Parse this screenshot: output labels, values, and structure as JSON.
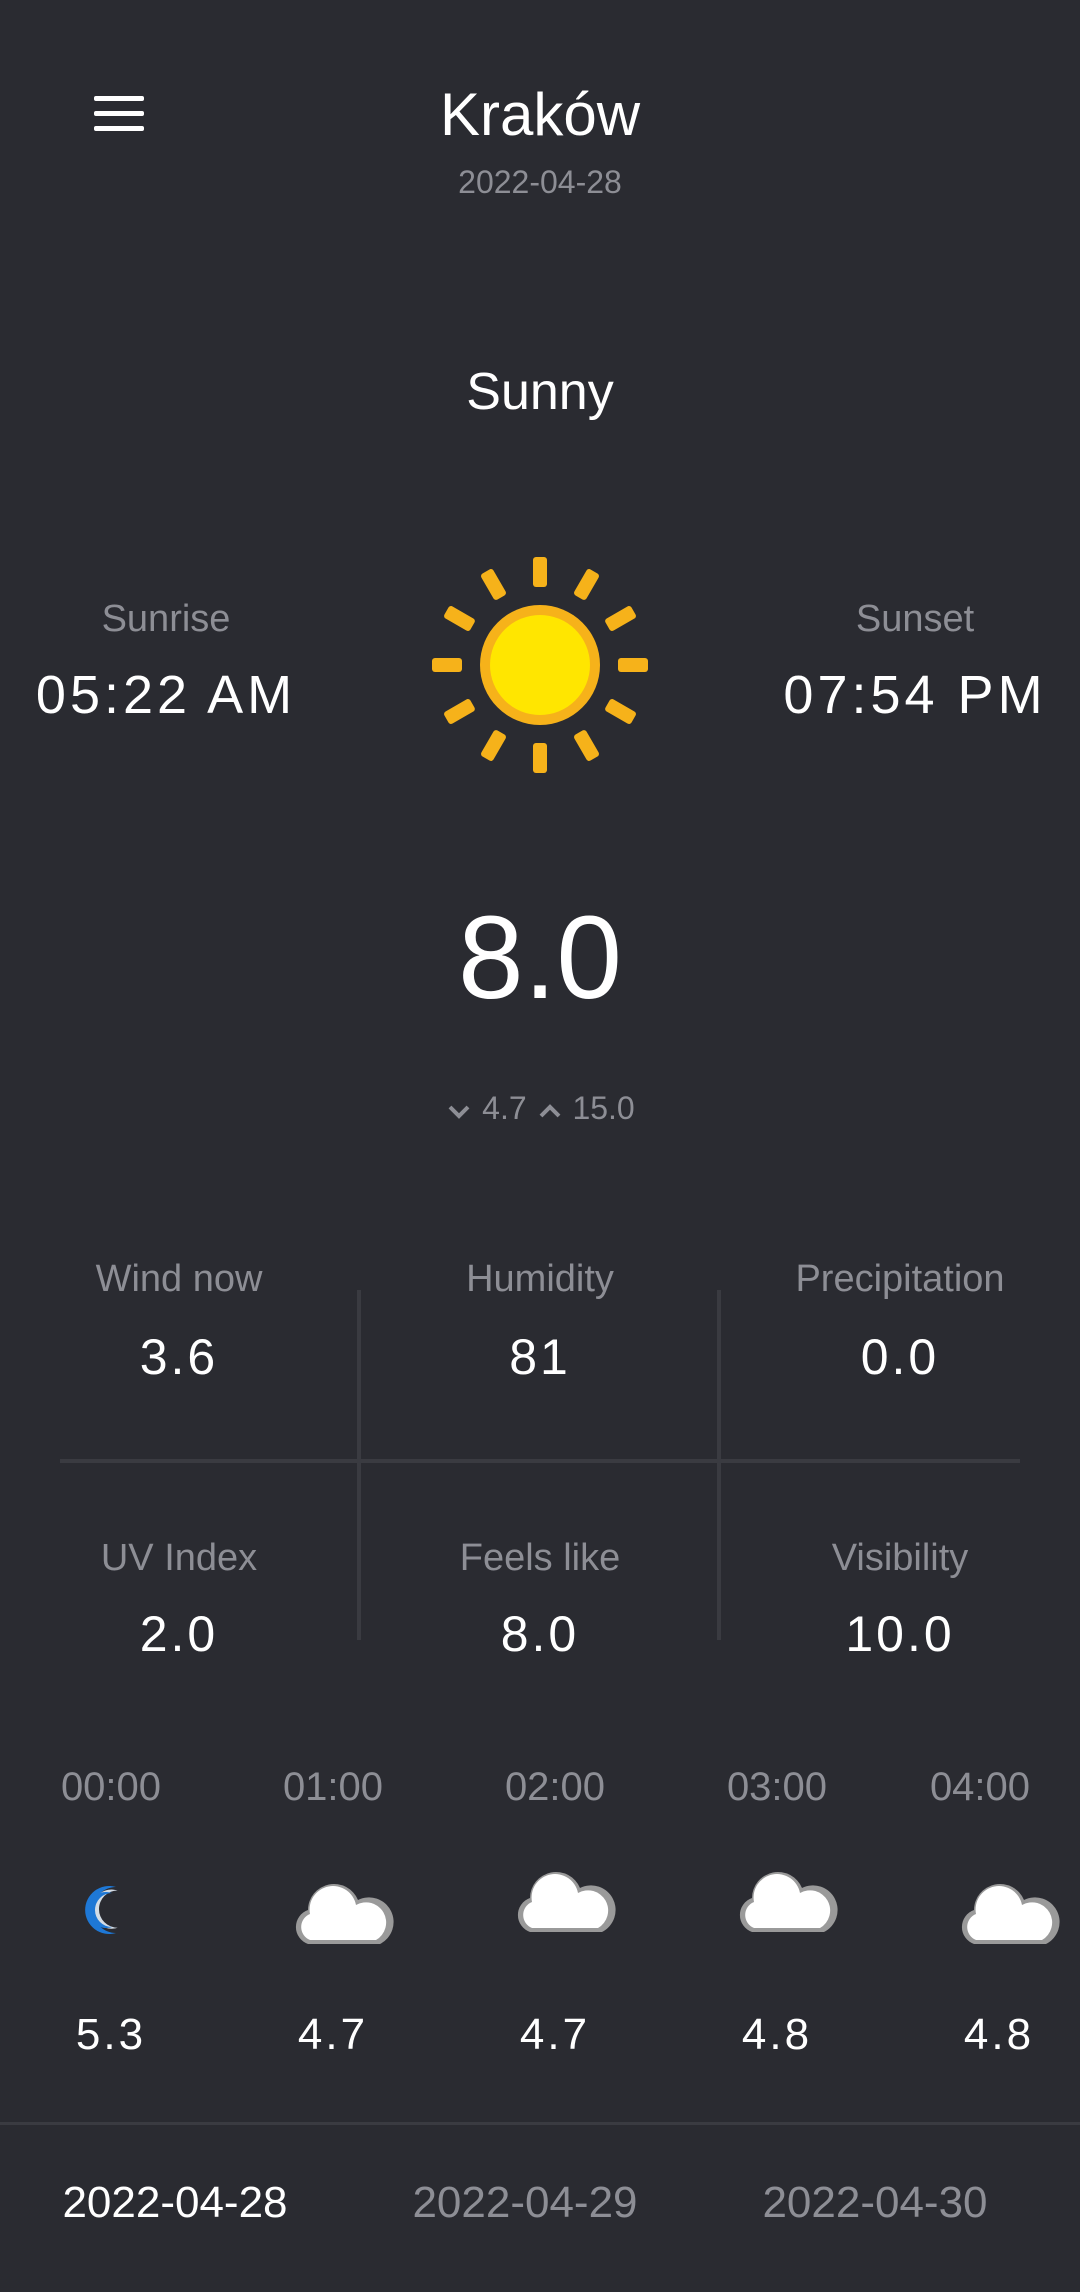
{
  "header": {
    "city": "Kraków",
    "date": "2022-04-28"
  },
  "current": {
    "condition": "Sunny",
    "icon": "sun-icon",
    "sunrise_label": "Sunrise",
    "sunrise": "05:22 AM",
    "sunset_label": "Sunset",
    "sunset": "07:54 PM",
    "temperature": "8.0",
    "min": "4.7",
    "max": "15.0"
  },
  "stats": [
    {
      "label": "Wind now",
      "value": "3.6"
    },
    {
      "label": "Humidity",
      "value": "81"
    },
    {
      "label": "Precipitation",
      "value": "0.0"
    },
    {
      "label": "UV Index",
      "value": "2.0"
    },
    {
      "label": "Feels like",
      "value": "8.0"
    },
    {
      "label": "Visibility",
      "value": "10.0"
    }
  ],
  "hourly": [
    {
      "time": "00:00",
      "icon": "moon-icon",
      "temp": "5.3"
    },
    {
      "time": "01:00",
      "icon": "moon-cloud-icon",
      "temp": "4.7"
    },
    {
      "time": "02:00",
      "icon": "moon-cloud-icon",
      "temp": "4.7"
    },
    {
      "time": "03:00",
      "icon": "moon-cloud-icon",
      "temp": "4.8"
    },
    {
      "time": "04:00",
      "icon": "moon-cloud-icon",
      "temp": "4.8"
    }
  ],
  "days": [
    {
      "label": "2022-04-28",
      "active": true
    },
    {
      "label": "2022-04-29",
      "active": false
    },
    {
      "label": "2022-04-30",
      "active": false
    }
  ],
  "colors": {
    "background": "#2a2b31",
    "muted_text": "#8d8e95",
    "sun_core": "#ffe600",
    "sun_rays": "#f6b21a",
    "moon": "#1e78d6",
    "cloud": "#ffffff"
  }
}
